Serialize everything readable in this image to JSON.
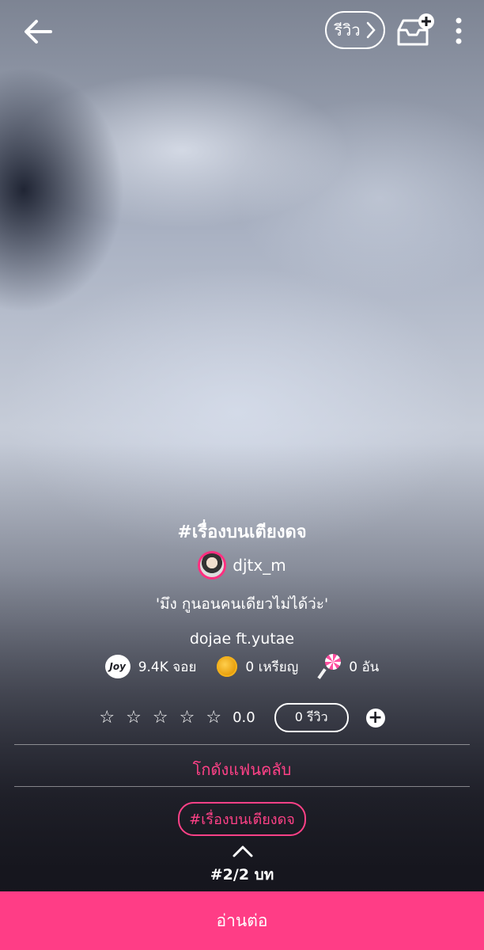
{
  "header": {
    "review_label": "รีวิว",
    "icons": [
      "back-arrow-icon",
      "chevron-right-icon",
      "add-to-shelf-icon",
      "more-vert-icon"
    ]
  },
  "story": {
    "title": "#เรื่องบนเตียงดจ",
    "author": "djtx_m",
    "tagline": "'มึง กูนอนคนเดียวไม่ได้ว่ะ'",
    "pairing": "dojae ft.yutae"
  },
  "stats": {
    "joy_badge": "Joy",
    "joy": "9.4K จอย",
    "coins": "0 เหรียญ",
    "lollipops": "0 อัน"
  },
  "rating": {
    "score": "0.0",
    "reviews": "0 รีวิว"
  },
  "fanclub_label": "โกดังแฟนคลับ",
  "tag": "#เรื่องบนเตียงดจ",
  "chapter": "#2/2 บท",
  "read_button": "อ่านต่อ",
  "colors": {
    "accent": "#ff3d86",
    "accent_text": "#ff4187"
  }
}
